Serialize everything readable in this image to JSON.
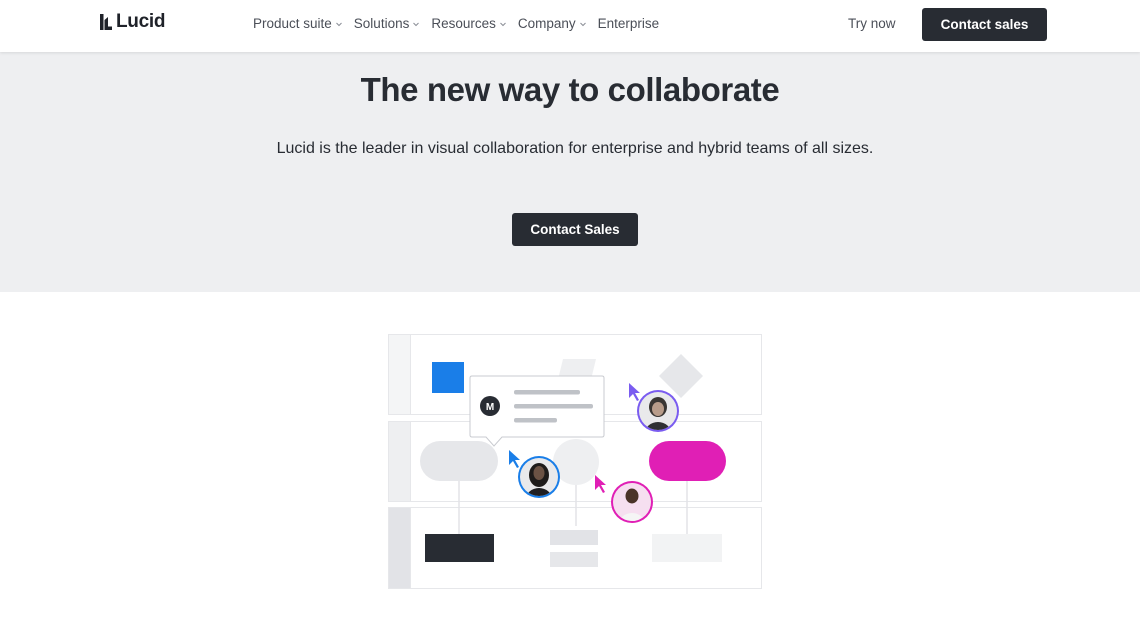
{
  "header": {
    "logo_text": "Lucid",
    "nav": [
      {
        "label": "Product suite",
        "has_dropdown": true
      },
      {
        "label": "Solutions",
        "has_dropdown": true
      },
      {
        "label": "Resources",
        "has_dropdown": true
      },
      {
        "label": "Company",
        "has_dropdown": true
      },
      {
        "label": "Enterprise",
        "has_dropdown": false
      }
    ],
    "try_now": "Try now",
    "contact_sales": "Contact sales"
  },
  "hero": {
    "title": "The new way to collaborate",
    "subtitle": "Lucid is the leader in visual collaboration for enterprise and hybrid teams of all sizes.",
    "cta": "Contact Sales"
  },
  "illustration": {
    "comment_avatar_letter": "M",
    "colors": {
      "blue": "#1a7ee8",
      "magenta": "#e01fb5",
      "dark": "#282c33",
      "light_gray": "#e6e7ea",
      "lavender": "#7a5cf0"
    }
  }
}
